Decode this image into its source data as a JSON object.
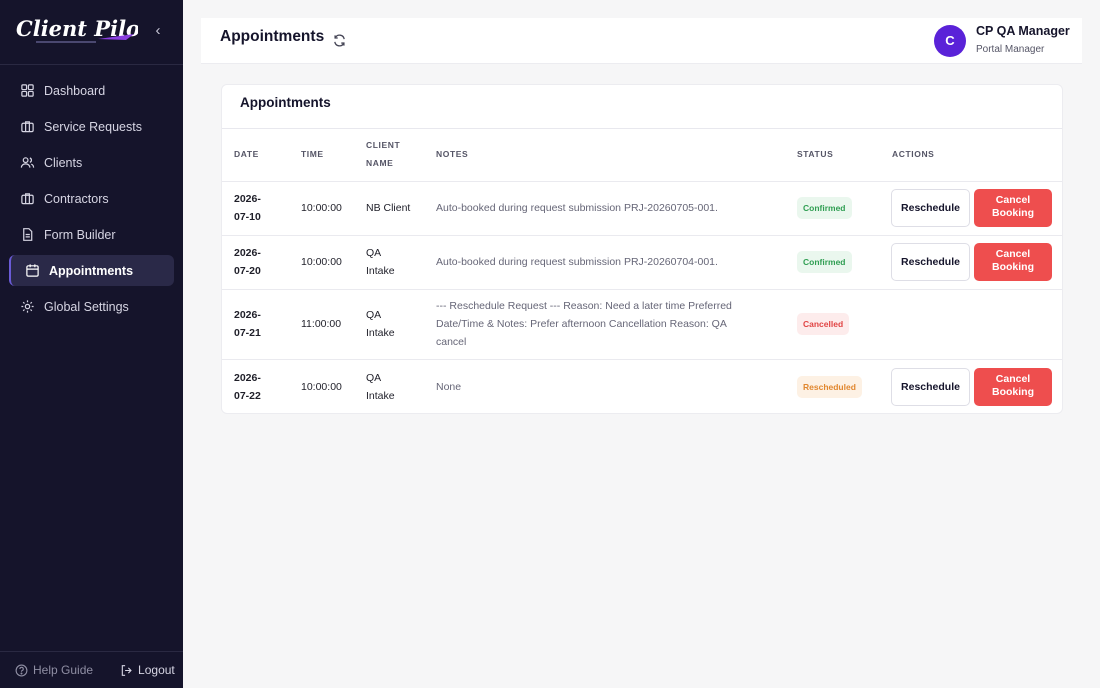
{
  "brand": {
    "logo_text": "Client Pilot",
    "accent": "#6a5bd6"
  },
  "sidebar": {
    "collapse_icon": "chevron-left-icon",
    "items": [
      {
        "label": "Dashboard",
        "icon": "grid-icon",
        "active": false
      },
      {
        "label": "Service Requests",
        "icon": "briefcase-icon",
        "active": false
      },
      {
        "label": "Clients",
        "icon": "users-icon",
        "active": false
      },
      {
        "label": "Contractors",
        "icon": "briefcase-icon",
        "active": false
      },
      {
        "label": "Form Builder",
        "icon": "document-icon",
        "active": false
      },
      {
        "label": "Appointments",
        "icon": "calendar-icon",
        "active": true
      },
      {
        "label": "Global Settings",
        "icon": "gear-icon",
        "active": false
      }
    ],
    "footer": {
      "help_label": "Help Guide",
      "logout_label": "Logout"
    }
  },
  "header": {
    "title": "Appointments",
    "user": {
      "initial": "C",
      "name": "CP QA Manager",
      "role": "Portal Manager"
    }
  },
  "main": {
    "card_title": "Appointments",
    "columns": {
      "date": "DATE",
      "time": "TIME",
      "client_1": "CLIENT",
      "client_2": "NAME",
      "notes": "NOTES",
      "status": "STATUS",
      "actions": "ACTIONS"
    },
    "rows": [
      {
        "date_1": "2026-",
        "date_2": "07-10",
        "time": "10:00:00",
        "client_1": "NB Client",
        "client_2": "",
        "notes": "Auto-booked during request submission PRJ-20260705-001.",
        "status": "Confirmed",
        "reschedule": "Reschedule",
        "cancel_1": "Cancel",
        "cancel_2": "Booking"
      },
      {
        "date_1": "2026-",
        "date_2": "07-20",
        "time": "10:00:00",
        "client_1": "QA",
        "client_2": "Intake",
        "notes": "Auto-booked during request submission PRJ-20260704-001.",
        "status": "Confirmed",
        "reschedule": "Reschedule",
        "cancel_1": "Cancel",
        "cancel_2": "Booking"
      },
      {
        "date_1": "2026-",
        "date_2": "07-21",
        "time": "11:00:00",
        "client_1": "QA",
        "client_2": "Intake",
        "notes_1": "--- Reschedule Request --- Reason: Need a later time Preferred",
        "notes_2": "Date/Time & Notes: Prefer afternoon Cancellation Reason: QA",
        "notes_3": "cancel",
        "status": "Cancelled"
      },
      {
        "date_1": "2026-",
        "date_2": "07-22",
        "time": "10:00:00",
        "client_1": "QA",
        "client_2": "Intake",
        "notes": "None",
        "status": "Rescheduled",
        "reschedule": "Reschedule",
        "cancel_1": "Cancel",
        "cancel_2": "Booking"
      }
    ]
  },
  "colors": {
    "sidebar_bg": "#15142b",
    "confirmed": "#2f9e52",
    "cancelled": "#e14444",
    "rescheduled": "#e1872f",
    "cancel_button": "#ee4e4e",
    "avatar": "#5a22d8"
  }
}
